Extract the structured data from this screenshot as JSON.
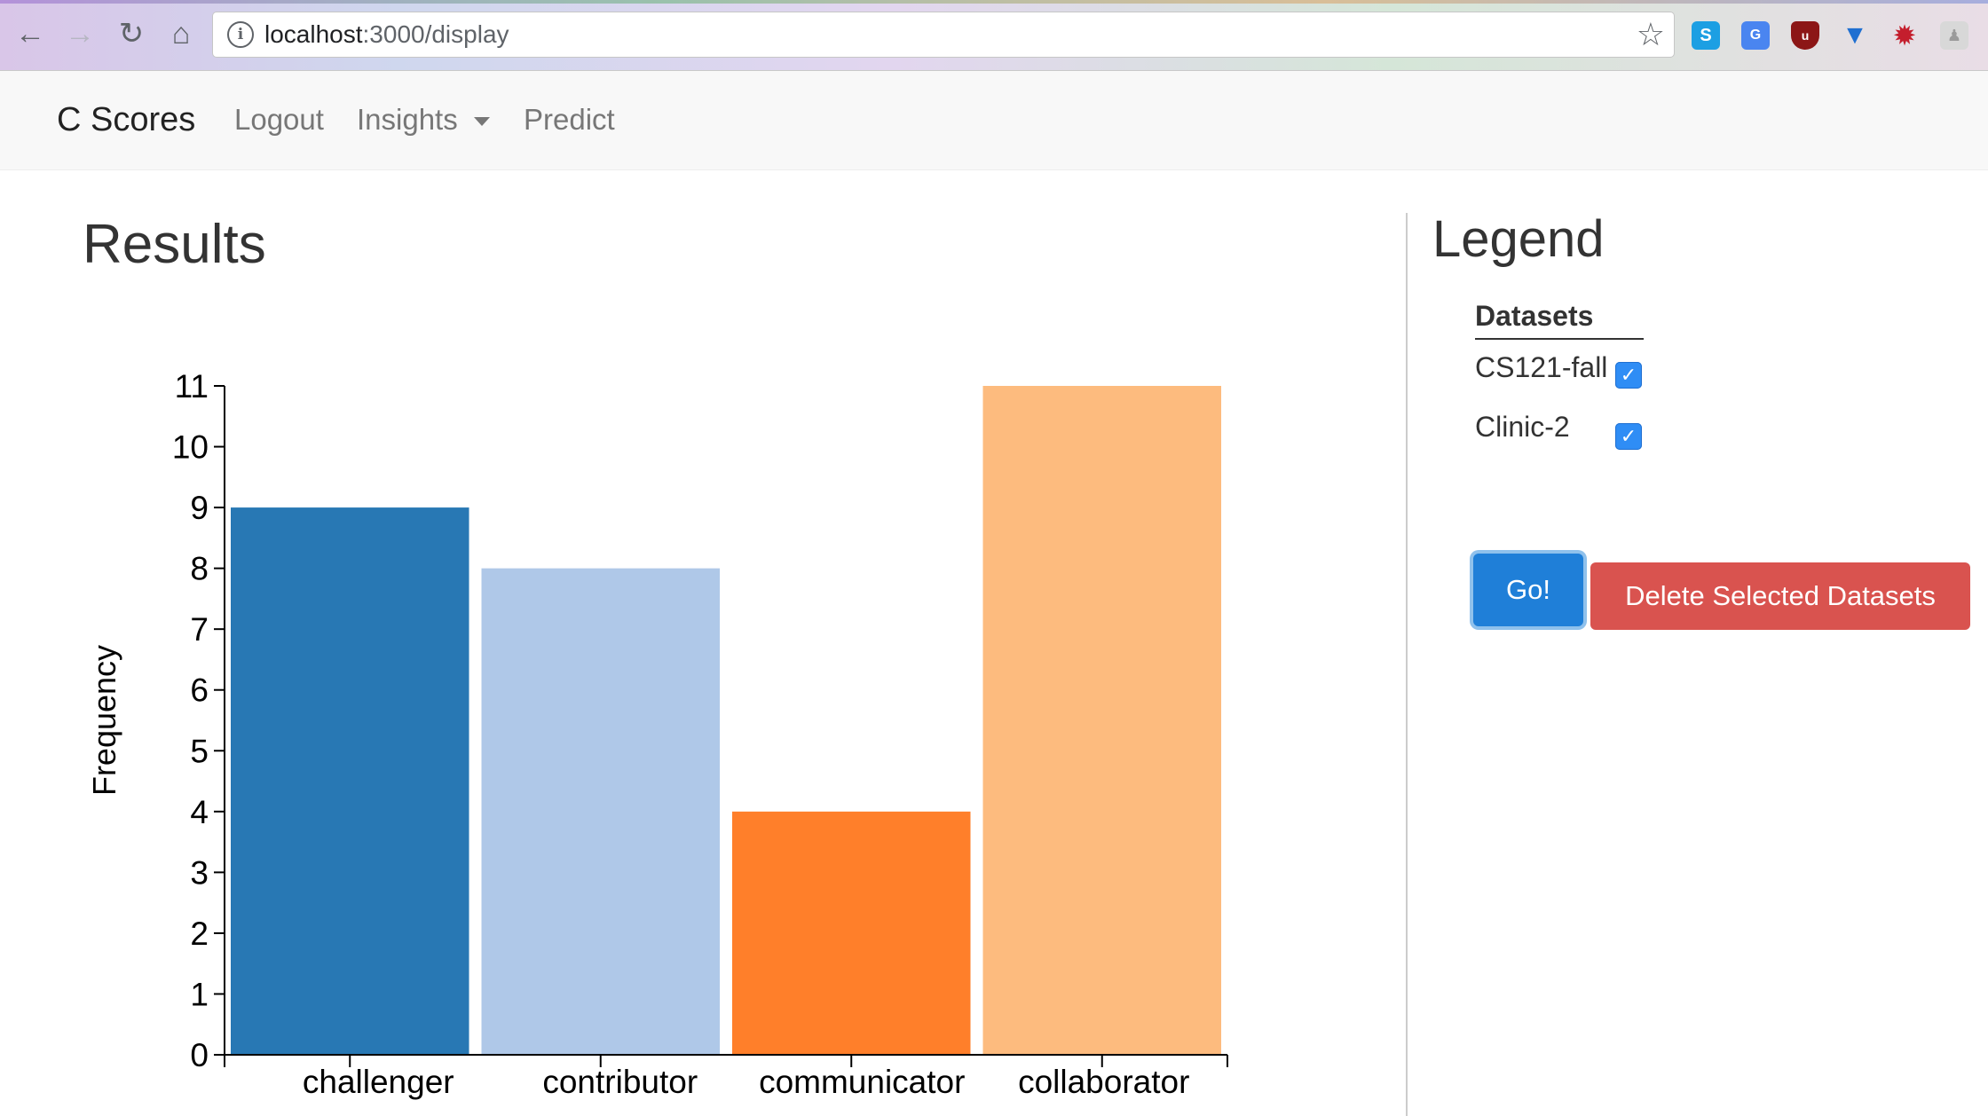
{
  "browser": {
    "url_host": "localhost",
    "url_path": ":3000/display",
    "nav_icons": [
      "back-icon",
      "forward-icon",
      "reload-icon",
      "home-icon"
    ],
    "extensions": [
      "skype-extension-icon",
      "translate-extension-icon",
      "ublock-extension-icon",
      "shield-extension-icon",
      "virus-extension-icon",
      "person-extension-icon"
    ]
  },
  "navbar": {
    "brand": "C Scores",
    "links": {
      "logout": "Logout",
      "insights": "Insights",
      "predict": "Predict"
    }
  },
  "main": {
    "title": "Results"
  },
  "chart_data": {
    "type": "bar",
    "categories": [
      "challenger",
      "contributor",
      "communicator",
      "collaborator"
    ],
    "values": [
      9,
      8,
      4,
      11
    ],
    "colors": [
      "#2878b4",
      "#afc8e8",
      "#ff7f2a",
      "#fdbb7e"
    ],
    "title": "",
    "xlabel": "",
    "ylabel": "Frequency",
    "ylim": [
      0,
      11
    ],
    "yticks": [
      "0",
      "1",
      "2",
      "3",
      "4",
      "5",
      "6",
      "7",
      "8",
      "9",
      "10",
      "11"
    ],
    "grid": false
  },
  "legend": {
    "title": "Legend",
    "datasets_header": "Datasets",
    "datasets": [
      {
        "label": "CS121-fall",
        "checked": true
      },
      {
        "label": "Clinic-2",
        "checked": true
      }
    ],
    "go_button": "Go!",
    "delete_button": "Delete Selected Datasets"
  },
  "colors": {
    "primary": "#1f7fd8",
    "danger": "#d9534f",
    "checkbox": "#2f8df5",
    "navbar_bg": "#f8f8f8"
  }
}
